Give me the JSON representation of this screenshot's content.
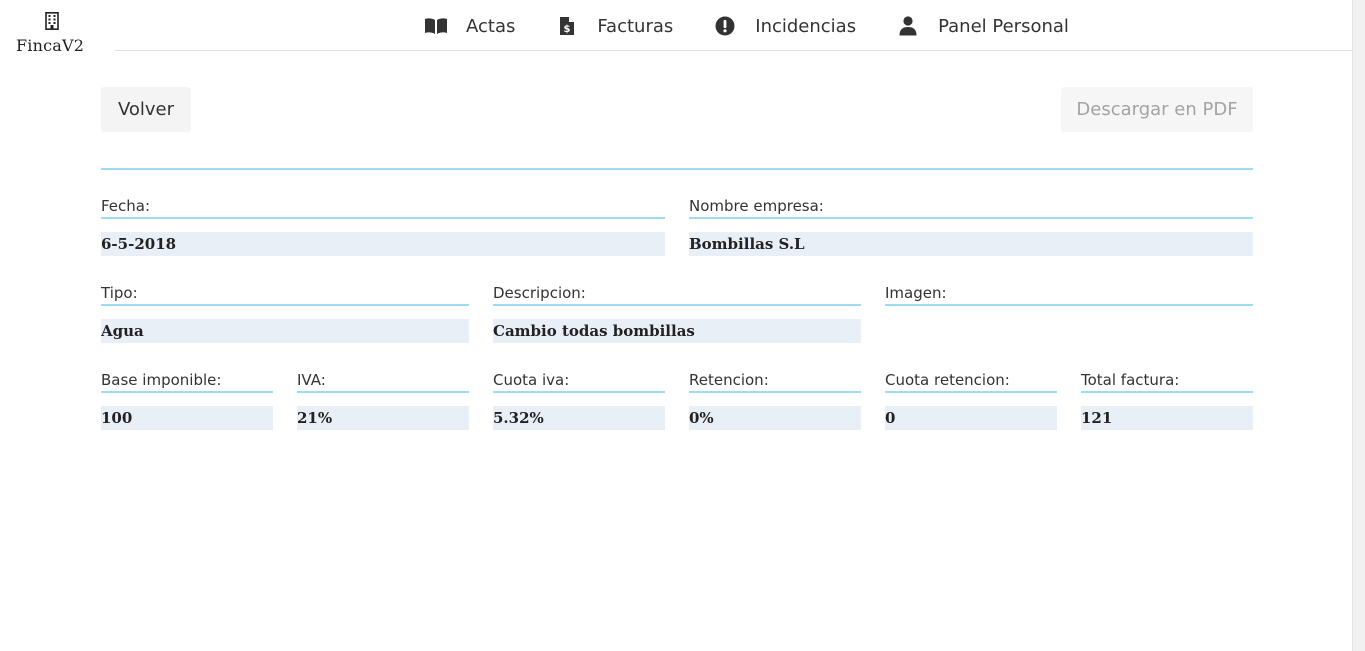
{
  "brand": {
    "name": "FincaV2",
    "icon": "building-icon"
  },
  "nav": [
    {
      "label": "Actas",
      "icon": "book-open-icon"
    },
    {
      "label": "Facturas",
      "icon": "file-invoice-dollar-icon"
    },
    {
      "label": "Incidencias",
      "icon": "exclamation-circle-icon"
    },
    {
      "label": "Panel Personal",
      "icon": "user-icon"
    }
  ],
  "actions": {
    "back_label": "Volver",
    "pdf_label": "Descargar en PDF"
  },
  "invoice": {
    "fecha": {
      "label": "Fecha:",
      "value": "6-5-2018"
    },
    "empresa": {
      "label": "Nombre empresa:",
      "value": "Bombillas S.L"
    },
    "tipo": {
      "label": "Tipo:",
      "value": "Agua"
    },
    "descripcion": {
      "label": "Descripcion:",
      "value": "Cambio todas bombillas"
    },
    "imagen": {
      "label": "Imagen:",
      "value": ""
    },
    "base": {
      "label": "Base imponible:",
      "value": "100"
    },
    "iva": {
      "label": "IVA:",
      "value": "21%"
    },
    "cuota_iva": {
      "label": "Cuota iva:",
      "value": "5.32%"
    },
    "retencion": {
      "label": "Retencion:",
      "value": "0%"
    },
    "cuota_retencion": {
      "label": "Cuota retencion:",
      "value": "0"
    },
    "total": {
      "label": "Total factura:",
      "value": "121"
    }
  },
  "colors": {
    "accent_line": "#9ddcf2",
    "value_bg": "#e8eff6",
    "button_bg": "#f4f4f4"
  }
}
